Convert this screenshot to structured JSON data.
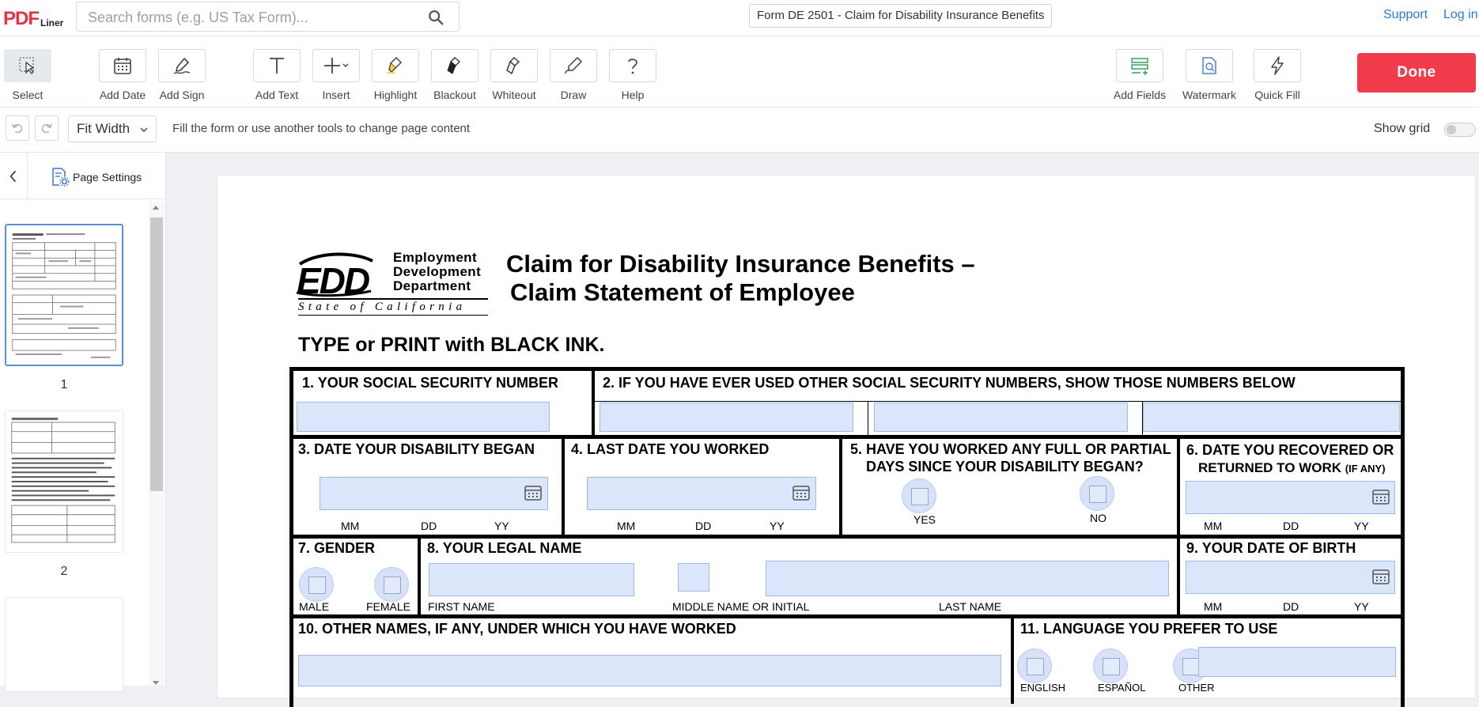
{
  "header": {
    "logo_main": "PDF",
    "logo_sub": "Liner",
    "search_placeholder": "Search forms (e.g. US Tax Form)...",
    "document_title": "Form DE 2501 - Claim for Disability Insurance Benefits",
    "support_label": "Support",
    "login_label": "Log in"
  },
  "toolbar": {
    "tools": [
      {
        "label": "Select",
        "icon": "cursor-select-icon"
      },
      {
        "label": "Add Date",
        "icon": "calendar-icon"
      },
      {
        "label": "Add Sign",
        "icon": "signature-pen-icon"
      },
      {
        "label": "Add Text",
        "icon": "text-t-icon"
      },
      {
        "label": "Insert",
        "icon": "plus-dropdown-icon"
      },
      {
        "label": "Highlight",
        "icon": "highlighter-icon"
      },
      {
        "label": "Blackout",
        "icon": "blackout-brush-icon"
      },
      {
        "label": "Whiteout",
        "icon": "whiteout-brush-icon"
      },
      {
        "label": "Draw",
        "icon": "draw-pencil-icon"
      },
      {
        "label": "Help",
        "icon": "question-icon"
      },
      {
        "label": "Add Fields",
        "icon": "add-fields-icon"
      },
      {
        "label": "Watermark",
        "icon": "watermark-icon"
      },
      {
        "label": "Quick Fill",
        "icon": "lightning-icon"
      }
    ],
    "done_label": "Done",
    "accent": "#f23c4b"
  },
  "subbar": {
    "zoom_label": "Fit Width",
    "hint": "Fill the form or use another tools to change page content",
    "grid_label": "Show grid",
    "grid_on": false
  },
  "sidebar": {
    "page_settings_label": "Page Settings",
    "pages": [
      "1",
      "2"
    ]
  },
  "form": {
    "agency_line1": "Employment",
    "agency_line2": "Development",
    "agency_line3": "Department",
    "agency_state": "State of California",
    "logo_letters": "EDD",
    "title_line1": "Claim for Disability Insurance Benefits –",
    "title_line2": "Claim Statement of Employee",
    "instruction": "TYPE or PRINT with BLACK INK.",
    "q1": "1. YOUR SOCIAL SECURITY NUMBER",
    "q2": "2. IF YOU HAVE EVER USED OTHER SOCIAL SECURITY NUMBERS, SHOW THOSE NUMBERS BELOW",
    "q3": "3. DATE YOUR DISABILITY BEGAN",
    "q4": "4. LAST DATE YOU WORKED",
    "q5_line1": "5. HAVE YOU WORKED ANY FULL OR PARTIAL",
    "q5_line2": "DAYS SINCE YOUR DISABILITY BEGAN?",
    "q6_line1": "6. DATE YOU RECOVERED OR",
    "q6_line2": "RETURNED TO WORK",
    "q6_note": "(IF ANY)",
    "q7": "7. GENDER",
    "q8": "8. YOUR LEGAL NAME",
    "q9": "9. YOUR DATE OF BIRTH",
    "q10": "10. OTHER NAMES, IF ANY, UNDER WHICH YOU HAVE WORKED",
    "q11": "11. LANGUAGE YOU PREFER TO USE",
    "mm": "MM",
    "dd": "DD",
    "yy": "YY",
    "yes": "YES",
    "no": "NO",
    "male": "MALE",
    "female": "FEMALE",
    "first_name": "FIRST NAME",
    "middle_name": "MIDDLE NAME OR INITIAL",
    "last_name": "LAST NAME",
    "lang_english": "ENGLISH",
    "lang_spanish": "ESPAÑOL",
    "lang_other": "OTHER"
  }
}
